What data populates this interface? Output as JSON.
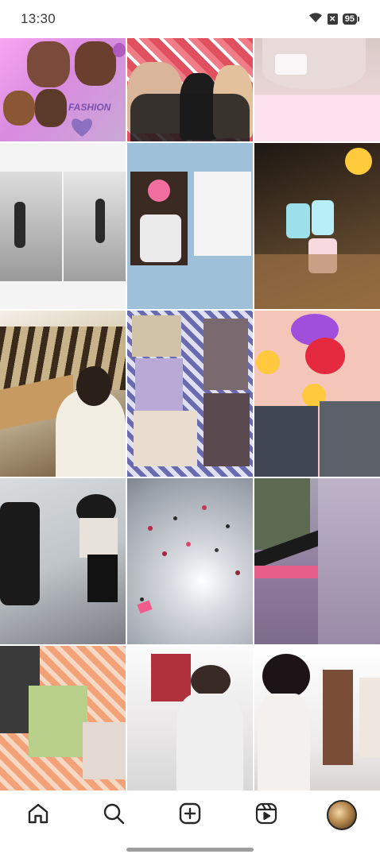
{
  "status_bar": {
    "time": "13:30",
    "battery_level": "95",
    "icons": [
      "wifi-icon",
      "no-sim-icon",
      "battery-icon"
    ]
  },
  "grid": {
    "columns": 3,
    "posts": [
      {
        "id": "post-1",
        "overlay_text": "FASHION"
      },
      {
        "id": "post-2",
        "overlay_text": ""
      },
      {
        "id": "post-3",
        "overlay_text": ""
      },
      {
        "id": "post-4",
        "overlay_text": ""
      },
      {
        "id": "post-5",
        "overlay_text": ""
      },
      {
        "id": "post-6",
        "overlay_text": ""
      },
      {
        "id": "post-7",
        "overlay_text": ""
      },
      {
        "id": "post-8",
        "overlay_text": ""
      },
      {
        "id": "post-9",
        "overlay_text": ""
      },
      {
        "id": "post-10",
        "overlay_text": ""
      },
      {
        "id": "post-11",
        "overlay_text": ""
      },
      {
        "id": "post-12",
        "overlay_text": ""
      },
      {
        "id": "post-13",
        "overlay_text": ""
      },
      {
        "id": "post-14",
        "overlay_text": ""
      },
      {
        "id": "post-15",
        "overlay_text": ""
      }
    ]
  },
  "bottom_nav": {
    "items": [
      {
        "name": "home",
        "icon": "home-icon"
      },
      {
        "name": "search",
        "icon": "search-icon"
      },
      {
        "name": "create",
        "icon": "plus-square-icon"
      },
      {
        "name": "reels",
        "icon": "reels-icon"
      },
      {
        "name": "profile",
        "icon": "profile-avatar"
      }
    ]
  },
  "colors": {
    "icon": "#262626",
    "status_text": "#3a3a3a",
    "background": "#ffffff"
  }
}
